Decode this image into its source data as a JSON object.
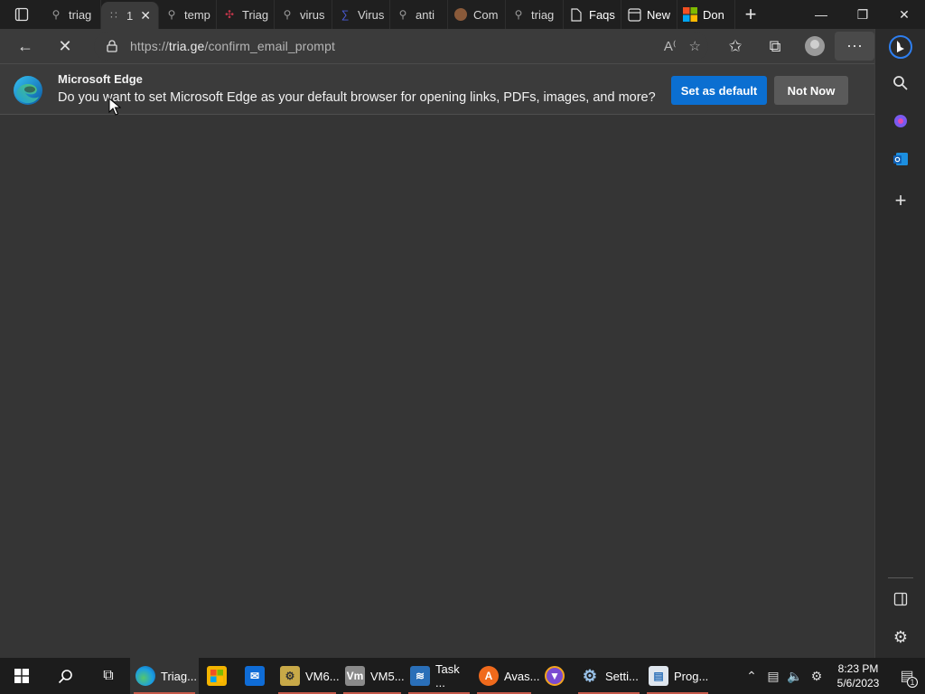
{
  "tabs": [
    {
      "label": "triag",
      "icon": "search-icon",
      "active": false
    },
    {
      "label": "1",
      "icon": "loading-icon",
      "active": true
    },
    {
      "label": "temp",
      "icon": "search-icon",
      "active": false
    },
    {
      "label": "Triag",
      "icon": "triage-logo-icon",
      "active": false
    },
    {
      "label": "virus",
      "icon": "search-icon",
      "active": false
    },
    {
      "label": "Virus",
      "icon": "virustotal-icon",
      "active": false
    },
    {
      "label": "anti",
      "icon": "search-icon",
      "active": false
    },
    {
      "label": "Com",
      "icon": "site-icon",
      "active": false
    },
    {
      "label": "triag",
      "icon": "search-icon",
      "active": false
    },
    {
      "label": "Faqs",
      "icon": "page-icon",
      "active": false
    },
    {
      "label": "New",
      "icon": "newtab-icon",
      "active": false
    },
    {
      "label": "Don",
      "icon": "microsoft-icon",
      "active": false
    }
  ],
  "address_bar": {
    "url_prefix": "https://",
    "url_host": "tria.ge",
    "url_path": "/confirm_email_prompt"
  },
  "infobar": {
    "title": "Microsoft Edge",
    "message": "Do you want to set Microsoft Edge as your default browser for opening links, PDFs, images, and more?",
    "primary_button": "Set as default",
    "secondary_button": "Not Now"
  },
  "taskbar": {
    "apps": [
      {
        "label": "Triag...",
        "icon": "edge-icon",
        "active": true
      },
      {
        "label": "",
        "icon": "store-icon",
        "active": false
      },
      {
        "label": "",
        "icon": "mail-icon",
        "active": false
      },
      {
        "label": "VM6...",
        "icon": "vm-icon",
        "active": false
      },
      {
        "label": "VM5...",
        "icon": "vmware-icon",
        "active": false
      },
      {
        "label": "Task ...",
        "icon": "task-manager-icon",
        "active": false
      },
      {
        "label": "Avas...",
        "icon": "avast-icon",
        "active": false
      },
      {
        "label": "",
        "icon": "shield-app-icon",
        "active": false
      },
      {
        "label": "Setti...",
        "icon": "settings-icon",
        "active": false
      },
      {
        "label": "Prog...",
        "icon": "programs-icon",
        "active": false
      }
    ],
    "time": "8:23 PM",
    "date": "5/6/2023",
    "notification_count": "1"
  },
  "colors": {
    "accent": "#0b6fd1",
    "page_bg": "#353535",
    "taskbar_active_indicator": "#c65a4a"
  }
}
